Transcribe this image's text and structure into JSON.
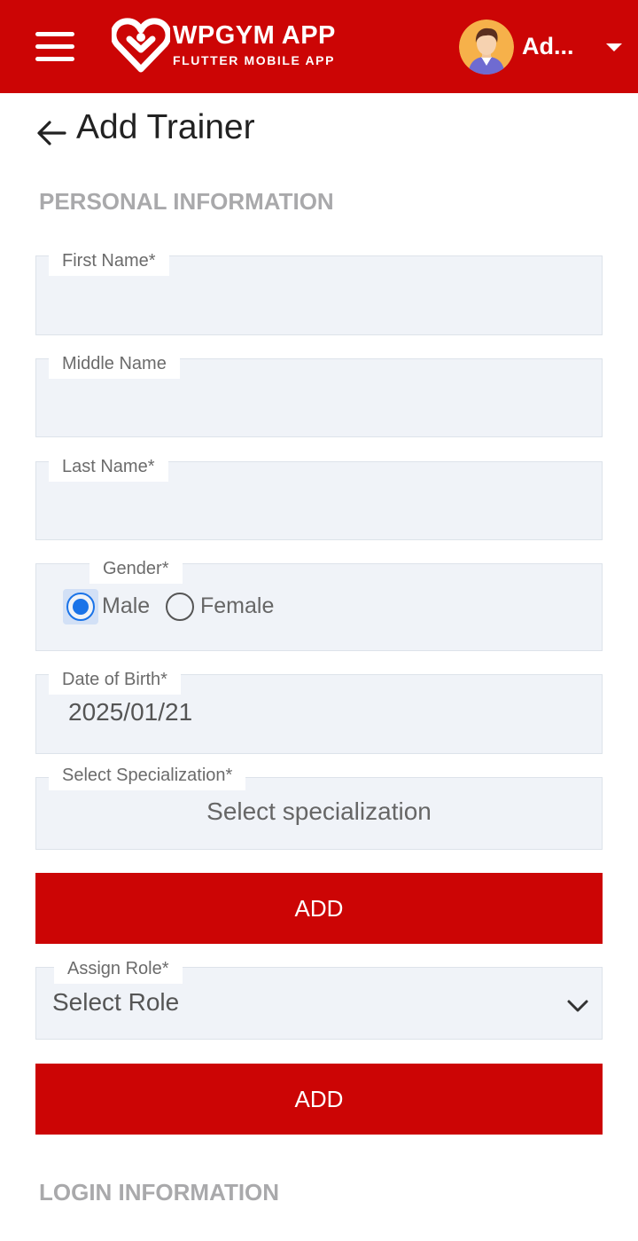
{
  "header": {
    "brand_title": "WPGYM APP",
    "brand_subtitle": "FLUTTER MOBILE APP",
    "user_name": "Ad...",
    "icons": {
      "menu": "hamburger-menu-icon",
      "logo": "heart-logo-icon",
      "dropdown": "caret-down-icon"
    },
    "colors": {
      "bar": "#cc0505",
      "text": "#ffffff"
    }
  },
  "page": {
    "title": "Add Trainer",
    "back_icon": "arrow-left-icon"
  },
  "sections": {
    "personal": "PERSONAL INFORMATION",
    "login": "LOGIN INFORMATION"
  },
  "form": {
    "first_name": {
      "label": "First Name*",
      "value": ""
    },
    "middle_name": {
      "label": "Middle Name",
      "value": ""
    },
    "last_name": {
      "label": "Last Name*",
      "value": ""
    },
    "gender": {
      "label": "Gender*",
      "options": [
        "Male",
        "Female"
      ],
      "selected": "Male"
    },
    "dob": {
      "label": "Date of Birth*",
      "value": "2025/01/21"
    },
    "specialization": {
      "label": "Select Specialization*",
      "placeholder": "Select specialization"
    },
    "specialization_add": "ADD",
    "role": {
      "label": "Assign Role*",
      "placeholder": "Select Role"
    },
    "role_add": "ADD"
  },
  "colors": {
    "accent": "#cc0505",
    "field_bg": "#f0f3f8",
    "radio_selected": "#1a73e8",
    "section_heading": "#a9a9ab"
  }
}
